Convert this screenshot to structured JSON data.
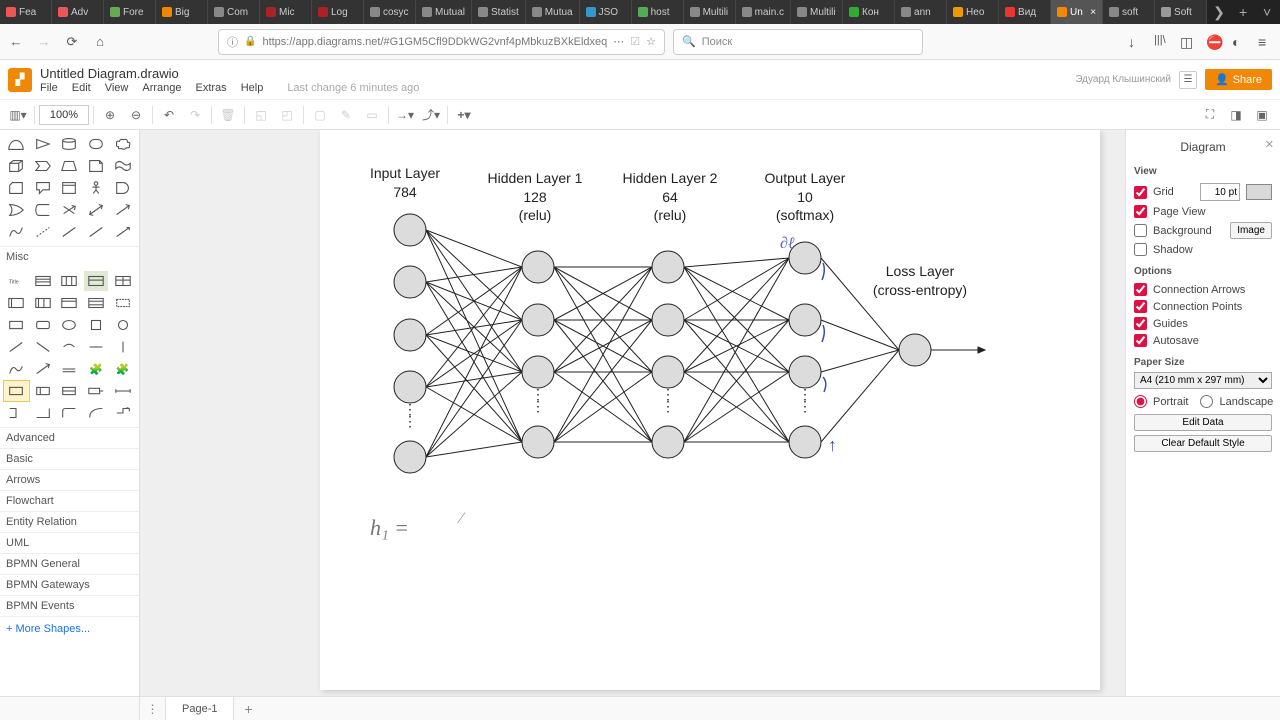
{
  "browser": {
    "tabs": [
      {
        "label": "Fea",
        "color": "#e55"
      },
      {
        "label": "Adv",
        "color": "#e55"
      },
      {
        "label": "Fore",
        "color": "#6a5"
      },
      {
        "label": "Big",
        "color": "#e80"
      },
      {
        "label": "Com",
        "color": "#888"
      },
      {
        "label": "Mic",
        "color": "#a22"
      },
      {
        "label": "Log",
        "color": "#a22"
      },
      {
        "label": "cosyc",
        "color": "#888"
      },
      {
        "label": "Mutual",
        "color": "#888"
      },
      {
        "label": "Statist",
        "color": "#888"
      },
      {
        "label": "Mutua",
        "color": "#888"
      },
      {
        "label": "JSO",
        "color": "#39c"
      },
      {
        "label": "host",
        "color": "#5a5"
      },
      {
        "label": "Multili",
        "color": "#888"
      },
      {
        "label": "main.c",
        "color": "#888"
      },
      {
        "label": "Multili",
        "color": "#888"
      },
      {
        "label": "Кон",
        "color": "#3a3"
      },
      {
        "label": "ann",
        "color": "#888"
      },
      {
        "label": "Нео",
        "color": "#e90"
      },
      {
        "label": "Вид",
        "color": "#e33"
      },
      {
        "label": "Un",
        "color": "#f08705",
        "active": true
      },
      {
        "label": "soft",
        "color": "#888"
      },
      {
        "label": "Soft",
        "color": "#999"
      }
    ],
    "url": "https://app.diagrams.net/#G1GM5Cfl9DDkWG2vnf4pMbkuzBXkEldxeq",
    "search_placeholder": "Поиск"
  },
  "app": {
    "doc_title": "Untitled Diagram.drawio",
    "menu": [
      "File",
      "Edit",
      "View",
      "Arrange",
      "Extras",
      "Help"
    ],
    "last_change": "Last change 6 minutes ago",
    "username": "Эдуард Клышинский",
    "share_label": "Share",
    "zoom": "100%",
    "page_tab": "Page-1",
    "more_shapes": "More Shapes..."
  },
  "sidebar_sections": [
    "Misc",
    "Advanced",
    "Basic",
    "Arrows",
    "Flowchart",
    "Entity Relation",
    "UML",
    "BPMN General",
    "BPMN Gateways",
    "BPMN Events"
  ],
  "format": {
    "title": "Diagram",
    "view_label": "View",
    "grid": {
      "label": "Grid",
      "checked": true,
      "value": "10 pt"
    },
    "page_view": {
      "label": "Page View",
      "checked": true
    },
    "background": {
      "label": "Background",
      "checked": false,
      "button": "Image"
    },
    "shadow": {
      "label": "Shadow",
      "checked": false
    },
    "options_label": "Options",
    "conn_arrows": {
      "label": "Connection Arrows",
      "checked": true
    },
    "conn_points": {
      "label": "Connection Points",
      "checked": true
    },
    "guides": {
      "label": "Guides",
      "checked": true
    },
    "autosave": {
      "label": "Autosave",
      "checked": true
    },
    "paper_label": "Paper Size",
    "paper_value": "A4 (210 mm x 297 mm)",
    "portrait": "Portrait",
    "landscape": "Landscape",
    "edit_data": "Edit Data",
    "clear_style": "Clear Default Style"
  },
  "diagram": {
    "layers": [
      {
        "title": "Input Layer",
        "sub1": "784",
        "sub2": ""
      },
      {
        "title": "Hidden Layer 1",
        "sub1": "128",
        "sub2": "(relu)"
      },
      {
        "title": "Hidden Layer 2",
        "sub1": "64",
        "sub2": "(relu)"
      },
      {
        "title": "Output Layer",
        "sub1": "10",
        "sub2": "(softmax)"
      }
    ],
    "loss": {
      "title": "Loss Layer",
      "sub": "(cross-entropy)"
    },
    "handwriting_eq": "h₁ ="
  }
}
